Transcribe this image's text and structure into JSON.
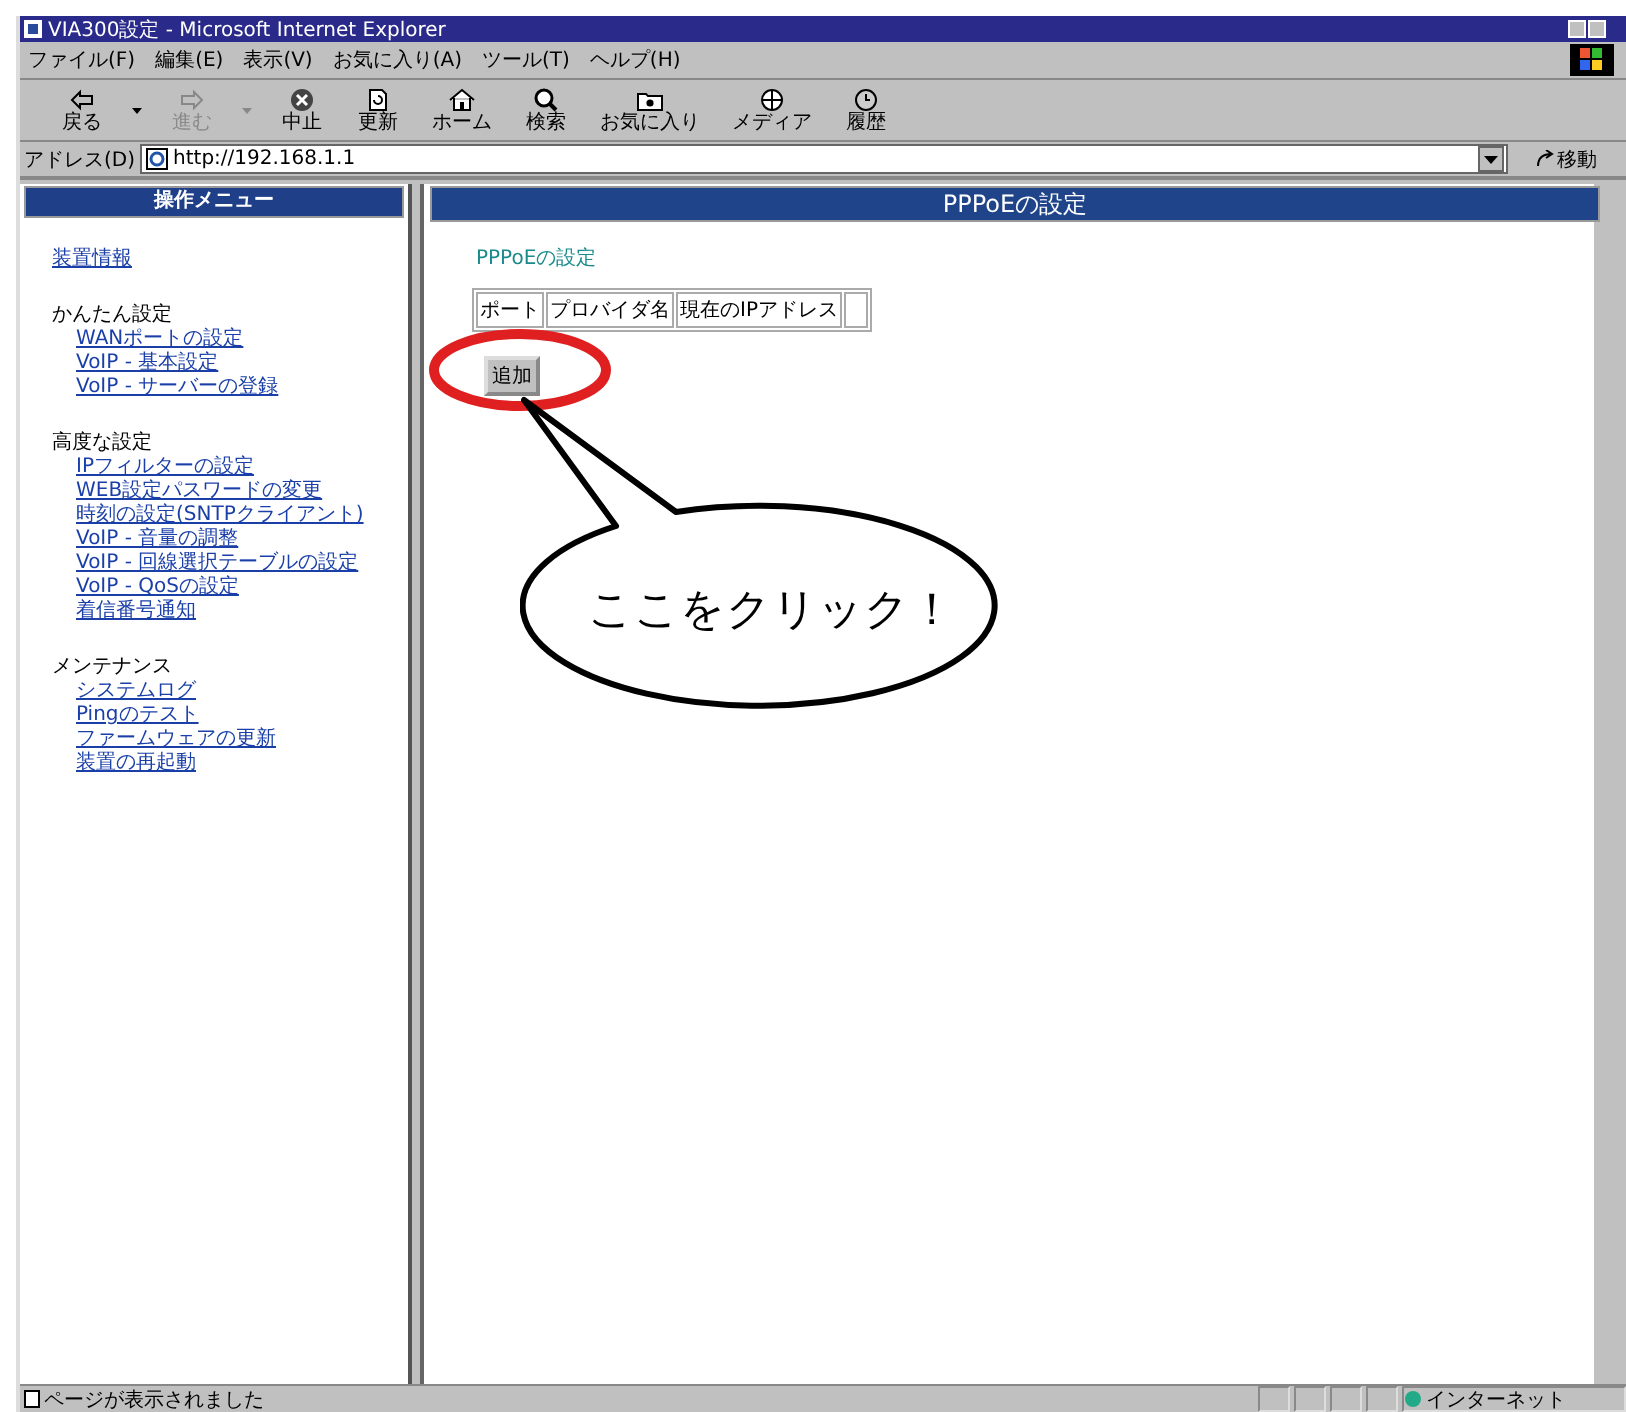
{
  "window": {
    "title": "VIA300設定 - Microsoft Internet Explorer"
  },
  "menu_bar": [
    "ファイル(F)",
    "編集(E)",
    "表示(V)",
    "お気に入り(A)",
    "ツール(T)",
    "ヘルプ(H)"
  ],
  "toolbar": [
    {
      "kind": "back",
      "label": "戻る",
      "disabled": false,
      "dropdown": true
    },
    {
      "kind": "forward",
      "label": "進む",
      "disabled": true,
      "dropdown": true
    },
    {
      "kind": "stop",
      "label": "中止",
      "disabled": false,
      "dropdown": false
    },
    {
      "kind": "refresh",
      "label": "更新",
      "disabled": false,
      "dropdown": false
    },
    {
      "kind": "home",
      "label": "ホーム",
      "disabled": false,
      "dropdown": false
    },
    {
      "kind": "search",
      "label": "検索",
      "disabled": false,
      "dropdown": false
    },
    {
      "kind": "favorites",
      "label": "お気に入り",
      "disabled": false,
      "dropdown": false
    },
    {
      "kind": "media",
      "label": "メディア",
      "disabled": false,
      "dropdown": false
    },
    {
      "kind": "history",
      "label": "履歴",
      "disabled": false,
      "dropdown": false
    }
  ],
  "address_bar": {
    "label": "アドレス(D)",
    "value": "http://192.168.1.1",
    "go": "移動"
  },
  "sidebar": {
    "title": "操作メニュー",
    "groups": [
      {
        "items": [
          "装置情報"
        ]
      },
      {
        "heading": "かんたん設定",
        "items": [
          "WANポートの設定",
          "VoIP - 基本設定",
          "VoIP - サーバーの登録"
        ]
      },
      {
        "heading": "高度な設定",
        "items": [
          "IPフィルターの設定",
          "WEB設定パスワードの変更",
          "時刻の設定(SNTPクライアント)",
          "VoIP - 音量の調整",
          "VoIP - 回線選択テーブルの設定",
          "VoIP - QoSの設定",
          "着信番号通知"
        ]
      },
      {
        "heading": "メンテナンス",
        "items": [
          "システムログ",
          "Pingのテスト",
          "ファームウェアの更新",
          "装置の再起動"
        ]
      }
    ]
  },
  "main": {
    "title": "PPPoEの設定",
    "subtitle": "PPPoEの設定",
    "table": {
      "columns": [
        "ポート",
        "プロバイダ名",
        "現在のIPアドレス",
        ""
      ]
    },
    "button": "追加"
  },
  "annotation": {
    "callout": "ここをクリック！"
  },
  "status_bar": {
    "message": "ページが表示されました",
    "zone": "インターネット"
  }
}
